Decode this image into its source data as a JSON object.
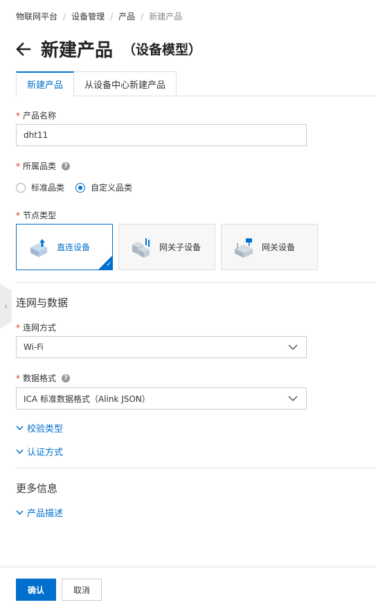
{
  "breadcrumb": {
    "items": [
      "物联网平台",
      "设备管理",
      "产品",
      "新建产品"
    ],
    "separator": "/"
  },
  "header": {
    "title": "新建产品",
    "subtitle": "（设备模型）"
  },
  "tabs": [
    {
      "label": "新建产品",
      "active": true
    },
    {
      "label": "从设备中心新建产品",
      "active": false
    }
  ],
  "form": {
    "required_mark": "*",
    "product_name": {
      "label": "产品名称",
      "value": "dht11"
    },
    "category": {
      "label": "所属品类",
      "help": "?",
      "options": [
        {
          "label": "标准品类",
          "checked": false
        },
        {
          "label": "自定义品类",
          "checked": true
        }
      ]
    },
    "node_type": {
      "label": "节点类型",
      "options": [
        {
          "label": "直连设备",
          "icon": "direct-device-icon",
          "selected": true
        },
        {
          "label": "网关子设备",
          "icon": "gateway-subdevice-icon",
          "selected": false
        },
        {
          "label": "网关设备",
          "icon": "gateway-device-icon",
          "selected": false
        }
      ]
    }
  },
  "section_network": {
    "title": "连网与数据",
    "network_method": {
      "label": "连网方式",
      "value": "Wi-Fi"
    },
    "data_format": {
      "label": "数据格式",
      "help": "?",
      "value": "ICA 标准数据格式（Alink JSON）"
    },
    "verify_type": "校验类型",
    "auth_method": "认证方式"
  },
  "section_more": {
    "title": "更多信息",
    "product_desc": "产品描述"
  },
  "footer": {
    "confirm": "确认",
    "cancel": "取消"
  },
  "side_handle": "‹",
  "check_glyph": "✓",
  "colors": {
    "accent": "#0070cc",
    "required": "#d93026",
    "text": "#333333",
    "muted": "#888888",
    "border": "#cccccc"
  }
}
